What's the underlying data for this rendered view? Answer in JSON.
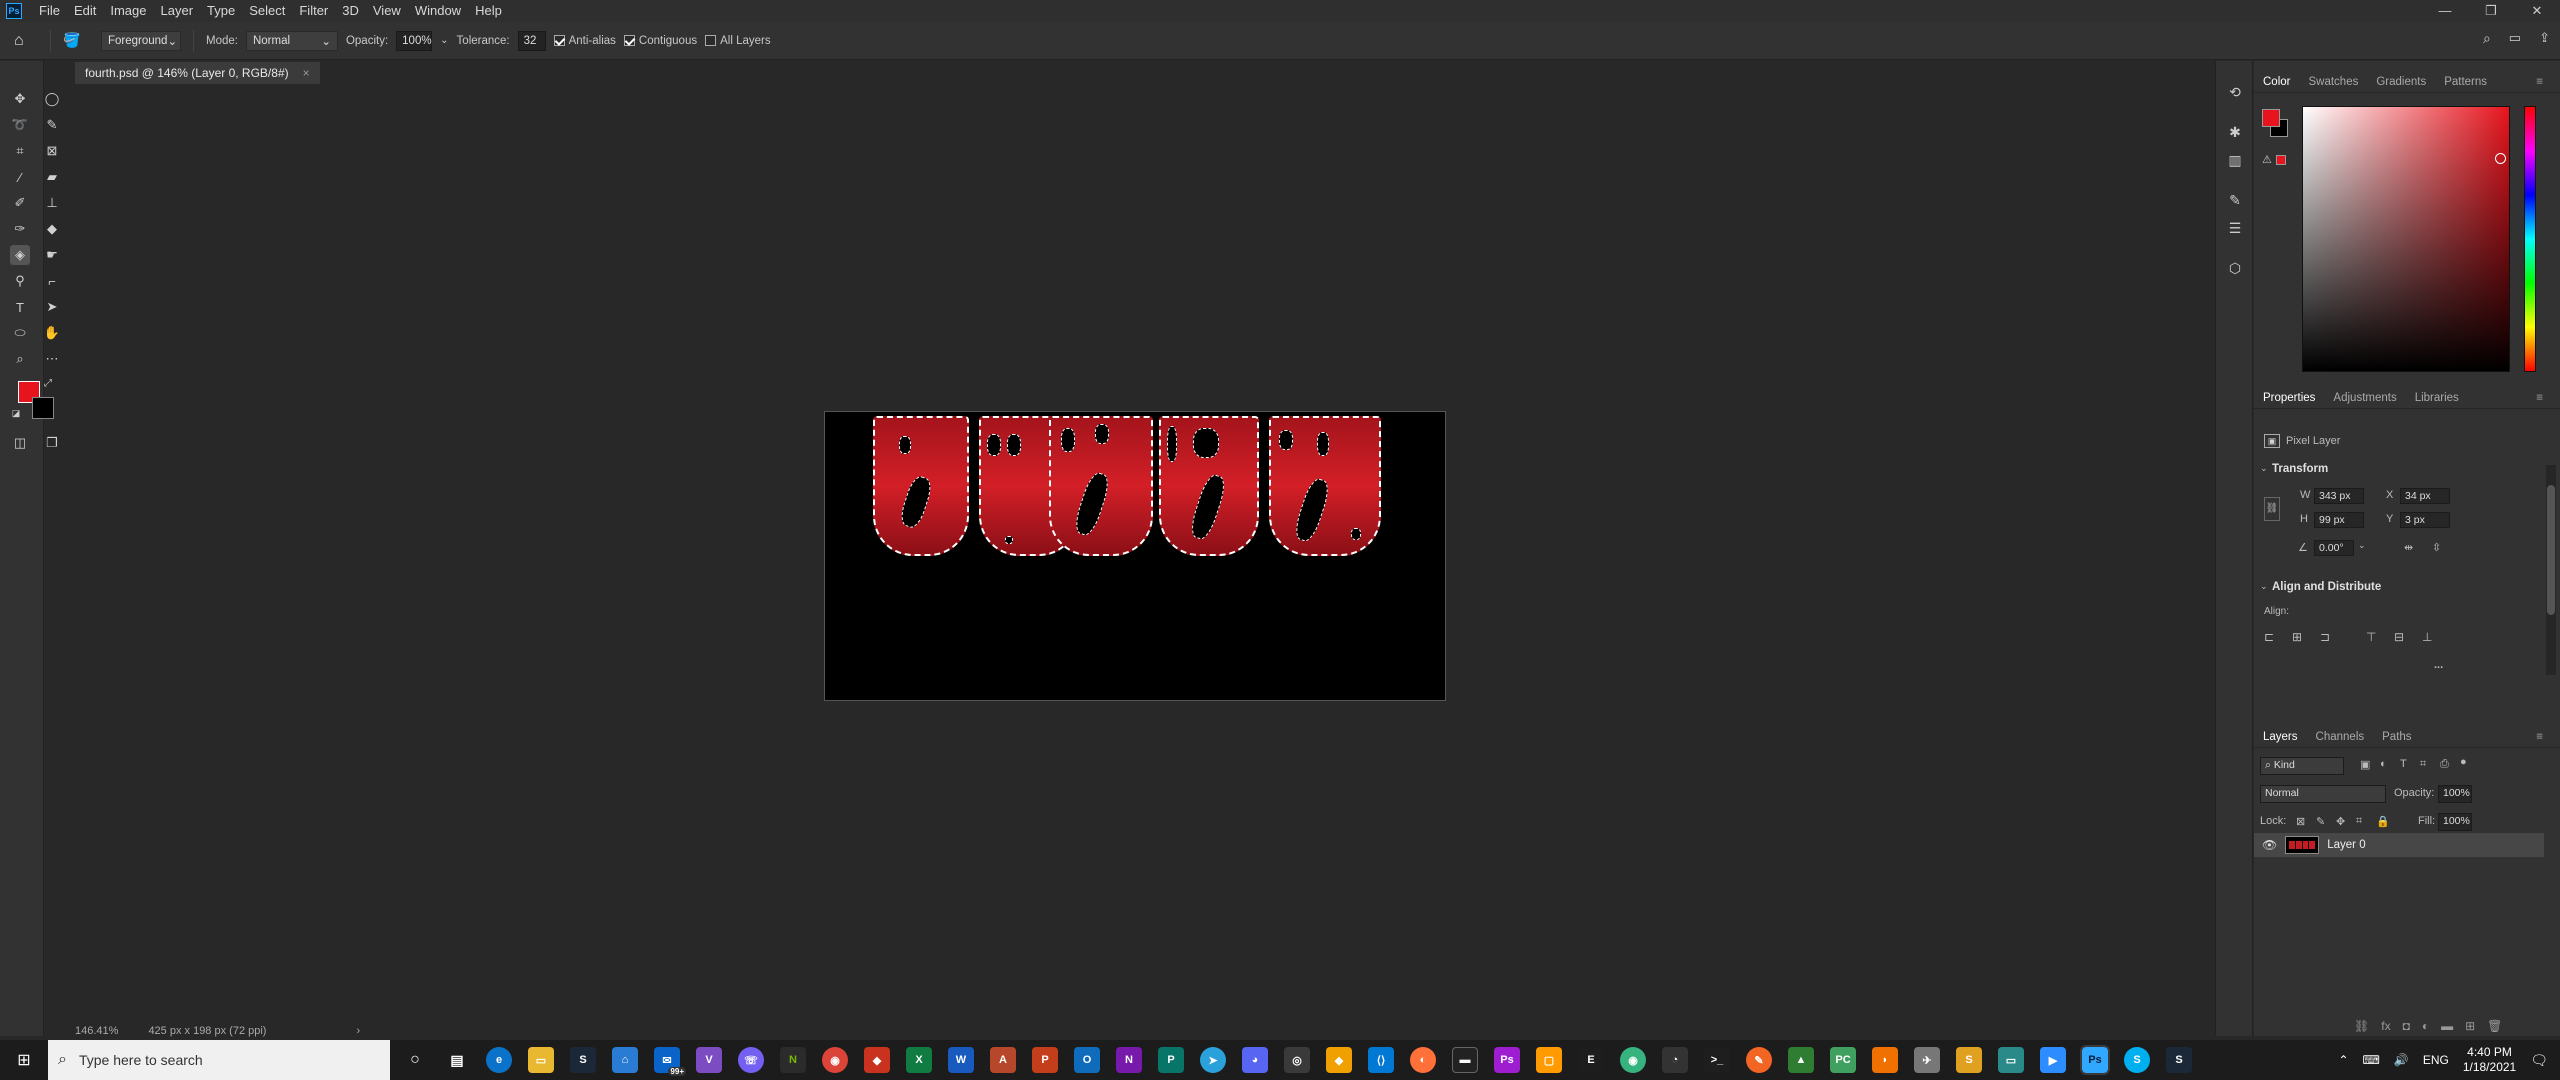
{
  "menubar": {
    "logo": "Ps",
    "items": [
      "File",
      "Edit",
      "Image",
      "Layer",
      "Type",
      "Select",
      "Filter",
      "3D",
      "View",
      "Window",
      "Help"
    ]
  },
  "window_controls": {
    "minimize": "—",
    "restore": "❐",
    "close": "✕"
  },
  "options": {
    "fill_source": "Foreground",
    "mode_label": "Mode:",
    "mode_value": "Normal",
    "opacity_label": "Opacity:",
    "opacity_value": "100%",
    "tolerance_label": "Tolerance:",
    "tolerance_value": "32",
    "antialias_label": "Anti-alias",
    "contiguous_label": "Contiguous",
    "all_layers_label": "All Layers"
  },
  "document": {
    "tab_title": "fourth.psd @ 146% (Layer 0, RGB/8#)",
    "close": "×"
  },
  "status": {
    "zoom": "146.41%",
    "doc_info": "425 px x 198 px (72 ppi)",
    "arrow": "›"
  },
  "color_panel": {
    "tabs": [
      "Color",
      "Swatches",
      "Gradients",
      "Patterns"
    ],
    "foreground": "#e8141d",
    "background": "#000000"
  },
  "properties_panel": {
    "tabs": [
      "Properties",
      "Adjustments",
      "Libraries"
    ],
    "layer_type": "Pixel Layer",
    "transform_title": "Transform",
    "w_label": "W",
    "w_value": "343 px",
    "h_label": "H",
    "h_value": "99 px",
    "x_label": "X",
    "x_value": "34 px",
    "y_label": "Y",
    "y_value": "3 px",
    "angle_value": "0.00°",
    "align_title": "Align and Distribute",
    "align_label": "Align:",
    "more": "..."
  },
  "layers_panel": {
    "tabs": [
      "Layers",
      "Channels",
      "Paths"
    ],
    "filter_kind": "Kind",
    "blend_mode": "Normal",
    "opacity_label": "Opacity:",
    "opacity_value": "100%",
    "lock_label": "Lock:",
    "fill_label": "Fill:",
    "fill_value": "100%",
    "layers": [
      {
        "name": "Layer 0"
      }
    ]
  },
  "taskbar": {
    "search_placeholder": "Type here to search",
    "language": "ENG",
    "time": "4:40 PM",
    "date": "1/18/2021",
    "mail_badge": "99+"
  }
}
